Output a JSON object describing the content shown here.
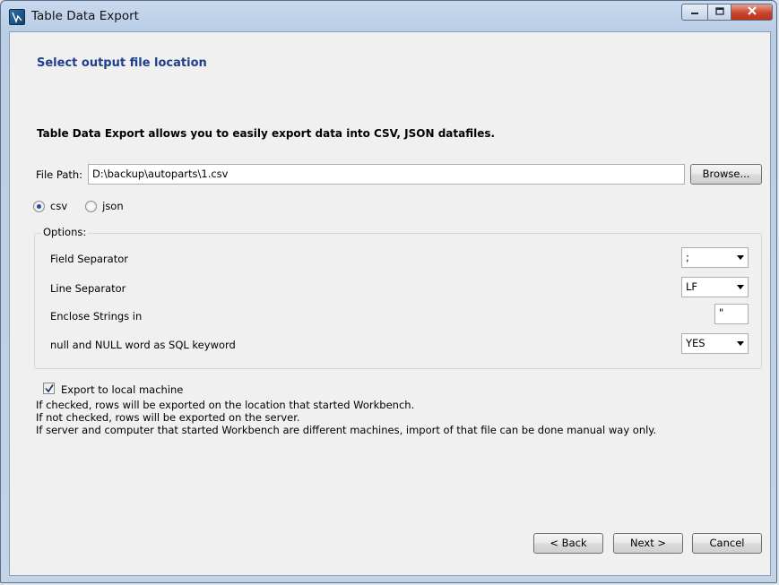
{
  "window": {
    "title": "Table Data Export",
    "minimize_glyph": "▭",
    "maximize_glyph": "□",
    "close_glyph": "✕"
  },
  "page": {
    "heading": "Select output file location",
    "intro": "Table Data Export allows you to easily export data into CSV, JSON datafiles."
  },
  "file_path": {
    "label": "File Path:",
    "value": "D:\\backup\\autoparts\\1.csv",
    "browse_label": "Browse..."
  },
  "format": {
    "options": [
      {
        "label": "csv",
        "selected": true
      },
      {
        "label": "json",
        "selected": false
      }
    ]
  },
  "options": {
    "group_label": "Options:",
    "field_separator": {
      "label": "Field Separator",
      "value": ";"
    },
    "line_separator": {
      "label": "Line Separator",
      "value": "LF"
    },
    "enclose_strings": {
      "label": "Enclose Strings in",
      "value": "\""
    },
    "null_keyword": {
      "label": "null and NULL word as SQL keyword",
      "value": "YES"
    }
  },
  "export_local": {
    "label": "Export to local machine",
    "checked": true,
    "notes": [
      "If checked, rows will be exported on the location that started Workbench.",
      "If not checked, rows will be exported on the server.",
      "If server and computer that started Workbench are different machines, import of that file can be done manual way only."
    ]
  },
  "footer": {
    "back_label": "< Back",
    "next_label": "Next >",
    "cancel_label": "Cancel"
  }
}
